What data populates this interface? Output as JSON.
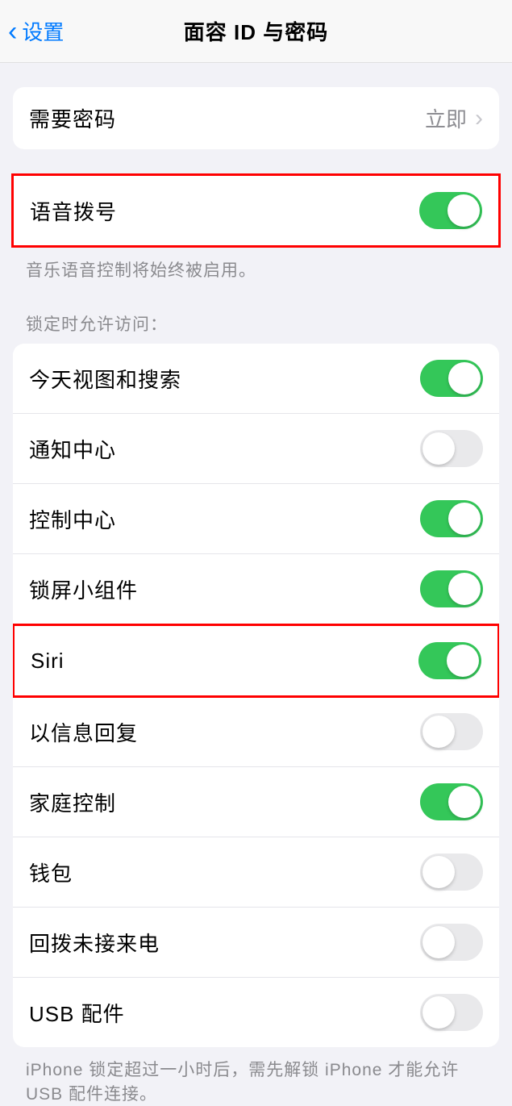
{
  "header": {
    "back_label": "设置",
    "title": "面容 ID 与密码"
  },
  "require_passcode": {
    "label": "需要密码",
    "value": "立即"
  },
  "voice_dial": {
    "label": "语音拨号",
    "enabled": true,
    "footer": "音乐语音控制将始终被启用。"
  },
  "lock_access": {
    "header": "锁定时允许访问：",
    "items": [
      {
        "label": "今天视图和搜索",
        "enabled": true
      },
      {
        "label": "通知中心",
        "enabled": false
      },
      {
        "label": "控制中心",
        "enabled": true
      },
      {
        "label": "锁屏小组件",
        "enabled": true
      },
      {
        "label": "Siri",
        "enabled": true
      },
      {
        "label": "以信息回复",
        "enabled": false
      },
      {
        "label": "家庭控制",
        "enabled": true
      },
      {
        "label": "钱包",
        "enabled": false
      },
      {
        "label": "回拨未接来电",
        "enabled": false
      },
      {
        "label": "USB 配件",
        "enabled": false
      }
    ],
    "footer": "iPhone 锁定超过一小时后，需先解锁 iPhone 才能允许 USB 配件连接。"
  }
}
